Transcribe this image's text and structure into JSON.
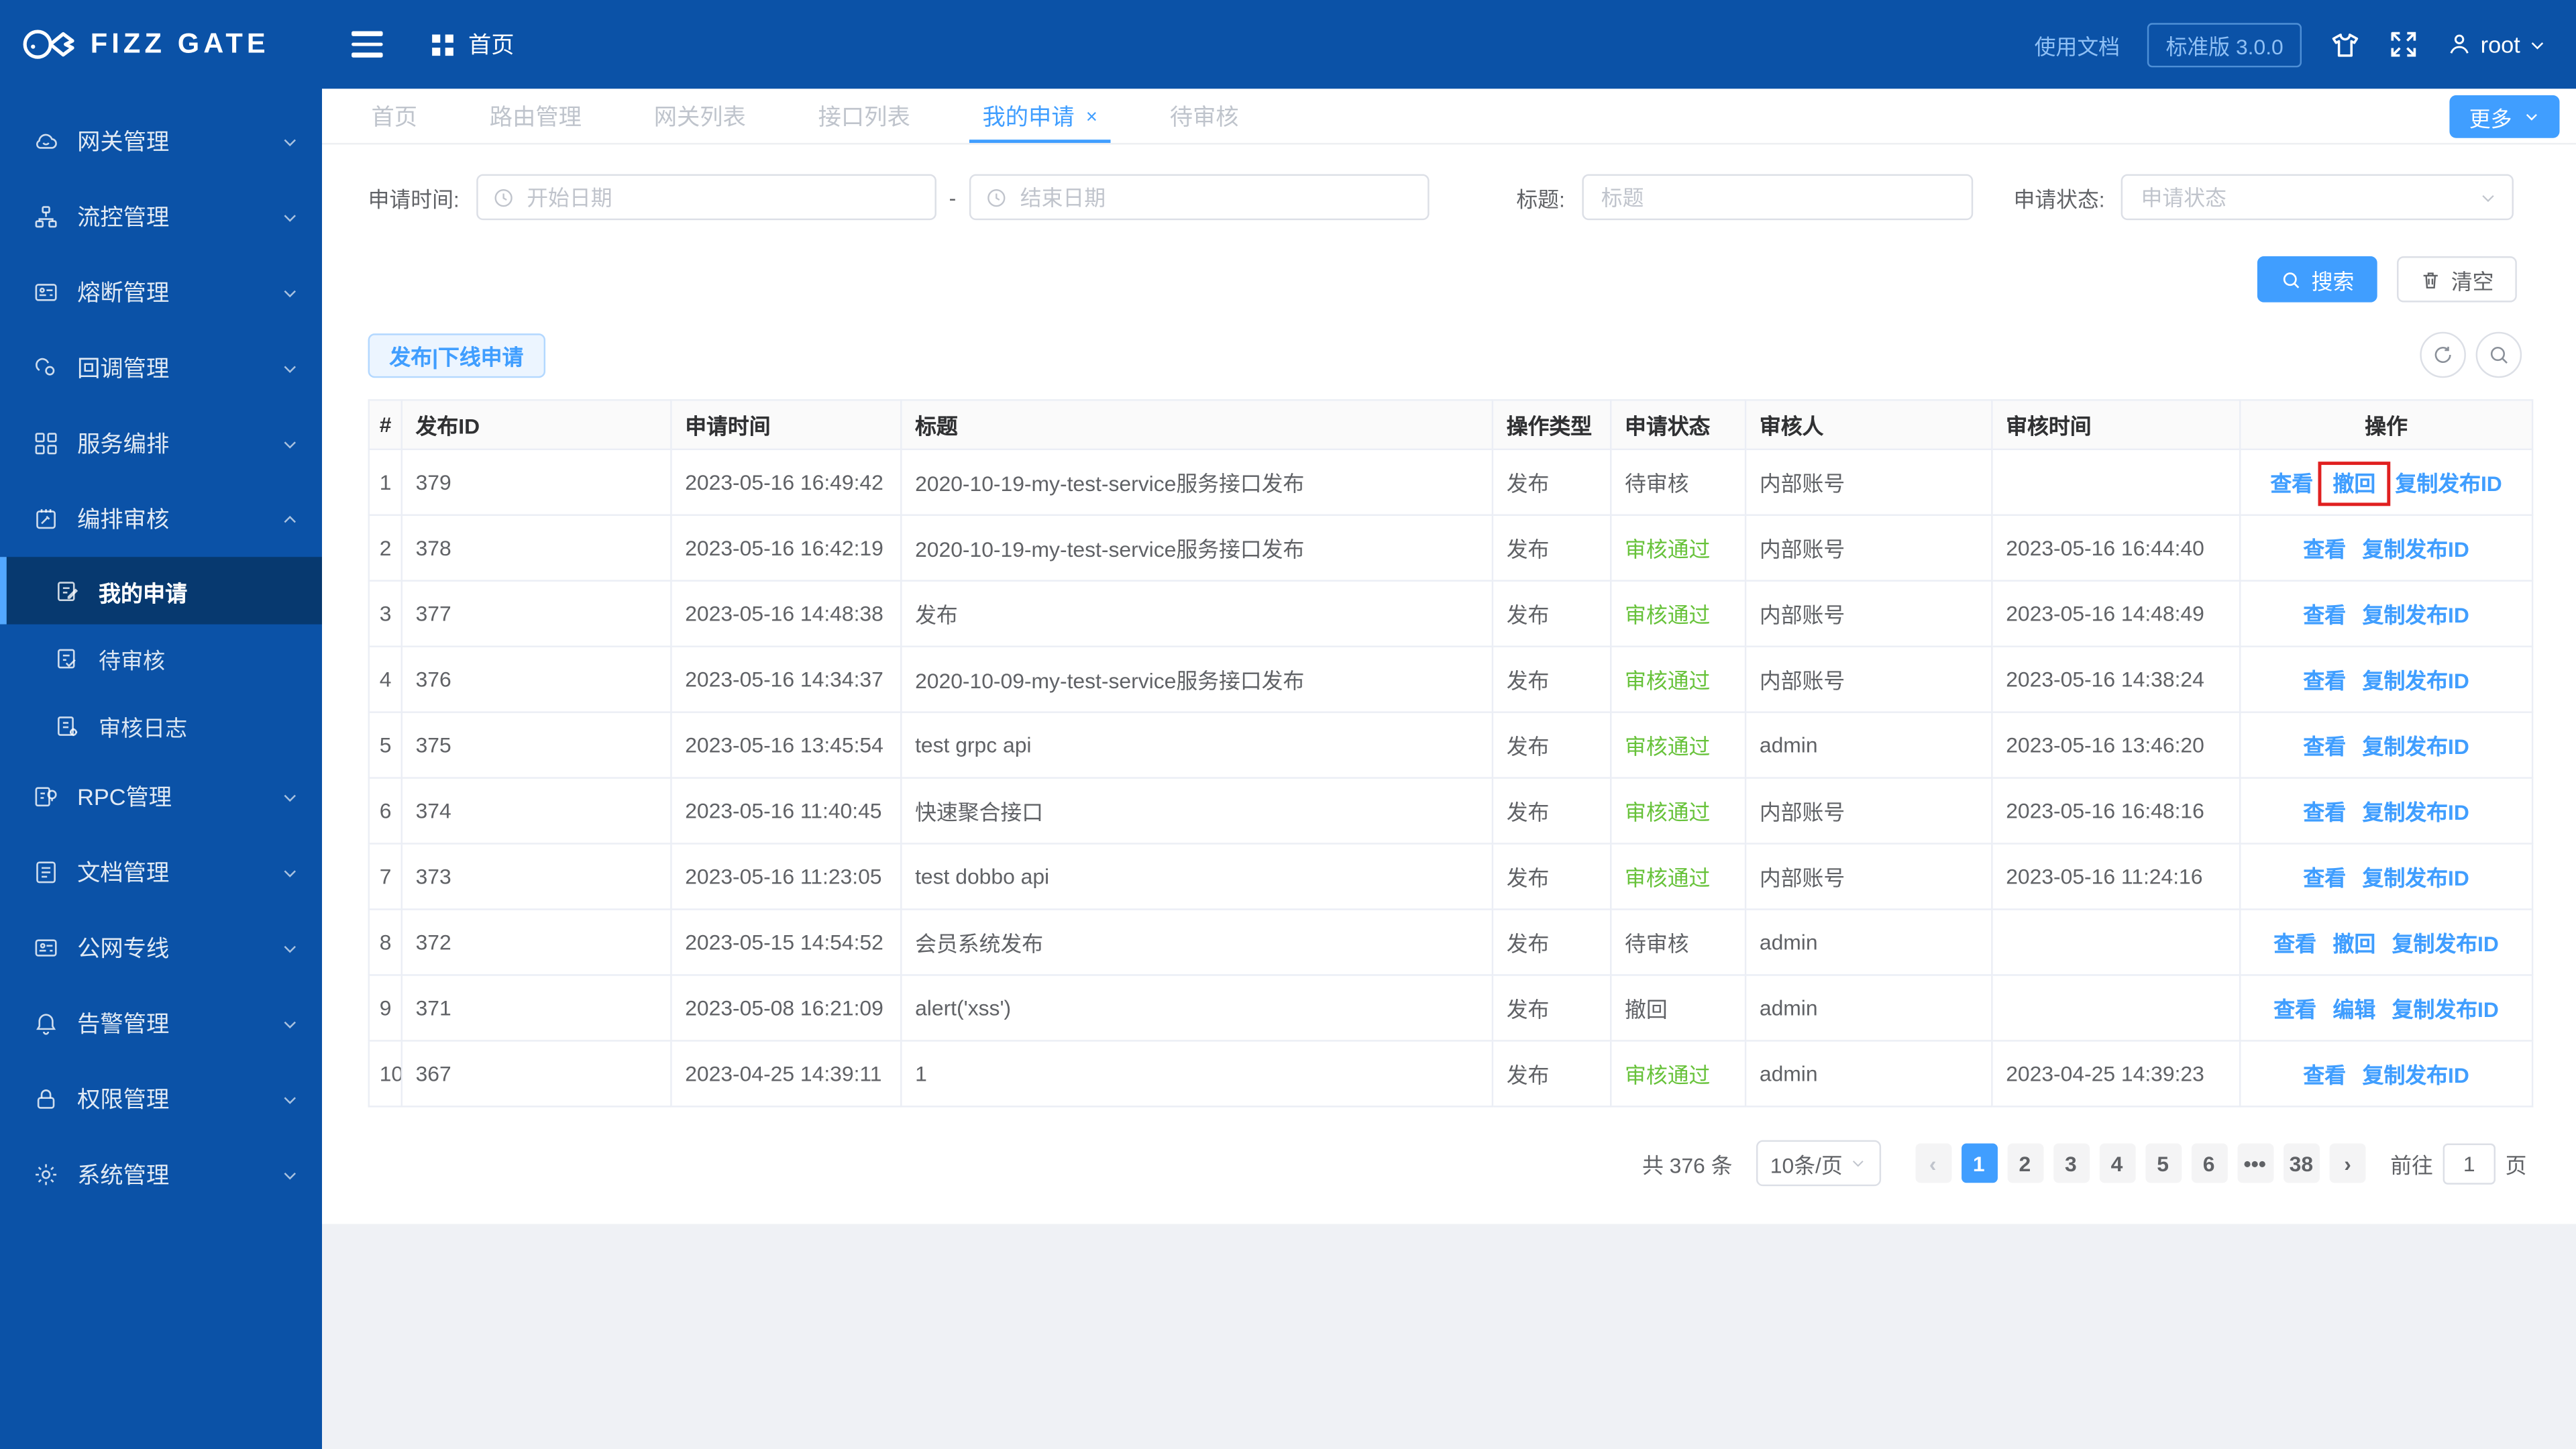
{
  "brand": {
    "name": "FIZZ GATE"
  },
  "colors": {
    "primary": "#409EFF",
    "sidebar_bg": "#0B52A7",
    "sidebar_active_bg": "#07396F",
    "sidebar_active_bar": "#53A8FF",
    "success": "#67C23A",
    "highlight_box": "#E02020",
    "text": "#606266"
  },
  "icons": {
    "logo": "fish",
    "menu-toggle": "hamburger",
    "home": "grid-squares",
    "theme": "t-shirt",
    "fullscreen": "expand-arrows",
    "user": "person",
    "dropdown": "chevron-down",
    "date": "clock",
    "search": "magnifier",
    "clear": "trash",
    "refresh": "arrows-rotate",
    "table-search": "magnifier"
  },
  "header": {
    "home_label": "首页",
    "docs_link": "使用文档",
    "version_badge": "标准版 3.0.0",
    "username": "root"
  },
  "sidebar": {
    "items": [
      {
        "label": "网关管理",
        "icon": "cloud-icon"
      },
      {
        "label": "流控管理",
        "icon": "flow-icon"
      },
      {
        "label": "熔断管理",
        "icon": "circuit-card-icon"
      },
      {
        "label": "回调管理",
        "icon": "callback-cloud-icon"
      },
      {
        "label": "服务编排",
        "icon": "grid-icon"
      },
      {
        "label": "编排审核",
        "icon": "audit-card-icon",
        "expanded": true,
        "children": [
          {
            "label": "我的申请",
            "icon": "doc-edit-icon",
            "active": true
          },
          {
            "label": "待审核",
            "icon": "doc-check-icon"
          },
          {
            "label": "审核日志",
            "icon": "doc-log-icon"
          }
        ]
      },
      {
        "label": "RPC管理",
        "icon": "rpc-icon"
      },
      {
        "label": "文档管理",
        "icon": "document-icon"
      },
      {
        "label": "公网专线",
        "icon": "line-card-icon"
      },
      {
        "label": "告警管理",
        "icon": "bell-icon"
      },
      {
        "label": "权限管理",
        "icon": "lock-icon"
      },
      {
        "label": "系统管理",
        "icon": "gear-icon"
      }
    ]
  },
  "tabs": [
    {
      "label": "首页"
    },
    {
      "label": "路由管理"
    },
    {
      "label": "网关列表"
    },
    {
      "label": "接口列表"
    },
    {
      "label": "我的申请",
      "active": true,
      "closable": true,
      "close_glyph": "×"
    },
    {
      "label": "待审核"
    }
  ],
  "more_button": {
    "label": "更多"
  },
  "filters": {
    "time_label": "申请时间:",
    "start_placeholder": "开始日期",
    "range_separator": "-",
    "end_placeholder": "结束日期",
    "title_label": "标题:",
    "title_placeholder": "标题",
    "status_label": "申请状态:",
    "status_placeholder": "申请状态",
    "search_button": "搜索",
    "clear_button": "清空"
  },
  "toolbar": {
    "publish_button": "发布|下线申请"
  },
  "table": {
    "columns": [
      "#",
      "发布ID",
      "申请时间",
      "标题",
      "操作类型",
      "申请状态",
      "审核人",
      "审核时间",
      "操作"
    ],
    "rows": [
      {
        "idx": "1",
        "publish_id": "379",
        "apply_time": "2023-05-16 16:49:42",
        "title": "2020-10-19-my-test-service服务接口发布",
        "op_type": "发布",
        "status": "待审核",
        "reviewer": "内部账号",
        "review_time": "",
        "actions": {
          "view": "查看",
          "middle": "撤回",
          "copy": "复制发布ID"
        },
        "highlighted_action": "撤回"
      },
      {
        "idx": "2",
        "publish_id": "378",
        "apply_time": "2023-05-16 16:42:19",
        "title": "2020-10-19-my-test-service服务接口发布",
        "op_type": "发布",
        "status": "审核通过",
        "reviewer": "内部账号",
        "review_time": "2023-05-16 16:44:40",
        "actions": {
          "view": "查看",
          "copy": "复制发布ID"
        }
      },
      {
        "idx": "3",
        "publish_id": "377",
        "apply_time": "2023-05-16 14:48:38",
        "title": "发布",
        "op_type": "发布",
        "status": "审核通过",
        "reviewer": "内部账号",
        "review_time": "2023-05-16 14:48:49",
        "actions": {
          "view": "查看",
          "copy": "复制发布ID"
        }
      },
      {
        "idx": "4",
        "publish_id": "376",
        "apply_time": "2023-05-16 14:34:37",
        "title": "2020-10-09-my-test-service服务接口发布",
        "op_type": "发布",
        "status": "审核通过",
        "reviewer": "内部账号",
        "review_time": "2023-05-16 14:38:24",
        "actions": {
          "view": "查看",
          "copy": "复制发布ID"
        }
      },
      {
        "idx": "5",
        "publish_id": "375",
        "apply_time": "2023-05-16 13:45:54",
        "title": "test grpc api",
        "op_type": "发布",
        "status": "审核通过",
        "reviewer": "admin",
        "review_time": "2023-05-16 13:46:20",
        "actions": {
          "view": "查看",
          "copy": "复制发布ID"
        }
      },
      {
        "idx": "6",
        "publish_id": "374",
        "apply_time": "2023-05-16 11:40:45",
        "title": "快速聚合接口",
        "op_type": "发布",
        "status": "审核通过",
        "reviewer": "内部账号",
        "review_time": "2023-05-16 16:48:16",
        "actions": {
          "view": "查看",
          "copy": "复制发布ID"
        }
      },
      {
        "idx": "7",
        "publish_id": "373",
        "apply_time": "2023-05-16 11:23:05",
        "title": "test dobbo api",
        "op_type": "发布",
        "status": "审核通过",
        "reviewer": "内部账号",
        "review_time": "2023-05-16 11:24:16",
        "actions": {
          "view": "查看",
          "copy": "复制发布ID"
        }
      },
      {
        "idx": "8",
        "publish_id": "372",
        "apply_time": "2023-05-15 14:54:52",
        "title": "会员系统发布",
        "op_type": "发布",
        "status": "待审核",
        "reviewer": "admin",
        "review_time": "",
        "actions": {
          "view": "查看",
          "middle": "撤回",
          "copy": "复制发布ID"
        }
      },
      {
        "idx": "9",
        "publish_id": "371",
        "apply_time": "2023-05-08 16:21:09",
        "title": "alert('xss')",
        "op_type": "发布",
        "status": "撤回",
        "reviewer": "admin",
        "review_time": "",
        "actions": {
          "view": "查看",
          "middle": "编辑",
          "copy": "复制发布ID"
        }
      },
      {
        "idx": "10",
        "publish_id": "367",
        "apply_time": "2023-04-25 14:39:11",
        "title": "1",
        "op_type": "发布",
        "status": "审核通过",
        "reviewer": "admin",
        "review_time": "2023-04-25 14:39:23",
        "actions": {
          "view": "查看",
          "copy": "复制发布ID"
        }
      }
    ]
  },
  "pagination": {
    "total_text": "共 376 条",
    "page_size": "10条/页",
    "prev_glyph": "‹",
    "next_glyph": "›",
    "pages": [
      "1",
      "2",
      "3",
      "4",
      "5",
      "6",
      "•••",
      "38"
    ],
    "active_page": "1",
    "goto_label": "前往",
    "goto_value": "1",
    "goto_unit": "页"
  }
}
